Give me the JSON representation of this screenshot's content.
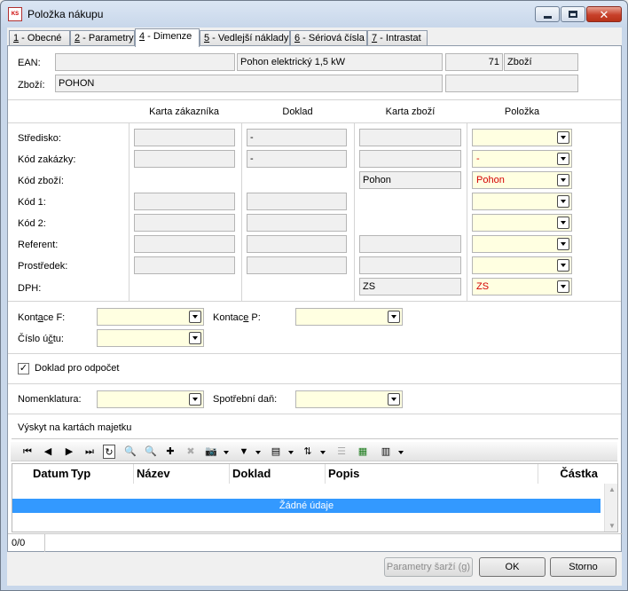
{
  "window": {
    "title": "Položka nákupu",
    "icon": "kos-app-icon"
  },
  "tabs": [
    {
      "key": "1",
      "label": " - Obecné"
    },
    {
      "key": "2",
      "label": " - Parametry"
    },
    {
      "key": "4",
      "label": " - Dimenze"
    },
    {
      "key": "5",
      "label": " - Vedlejší náklady"
    },
    {
      "key": "6",
      "label": " - Sériová čísla"
    },
    {
      "key": "7",
      "label": " - Intrastat"
    }
  ],
  "header": {
    "ean_label": "EAN:",
    "ean_value": "",
    "name": "Pohon elektrický 1,5 kW",
    "number": "71",
    "kind": "Zboží",
    "zbozi_label": "Zboží:",
    "zbozi_value": "POHON",
    "zbozi_extra": ""
  },
  "dims": {
    "columns": [
      "Karta zákazníka",
      "Doklad",
      "Karta zboží",
      "Položka"
    ],
    "rows": [
      {
        "label": "Středisko:",
        "doklad": "-",
        "karta_zbozi": "",
        "polozka": ""
      },
      {
        "label": "Kód zakázky:",
        "doklad": "-",
        "karta_zbozi": "",
        "polozka": "-"
      },
      {
        "label": "Kód zboží:",
        "doklad": "",
        "karta_zbozi": "Pohon",
        "polozka": "Pohon"
      },
      {
        "label": "Kód 1:",
        "doklad": "",
        "karta_zbozi": "",
        "polozka": ""
      },
      {
        "label": "Kód 2:",
        "doklad": "",
        "karta_zbozi": "",
        "polozka": ""
      },
      {
        "label": "Referent:",
        "doklad": "",
        "karta_zbozi": "",
        "polozka": ""
      },
      {
        "label": "Prostředek:",
        "doklad": "",
        "karta_zbozi": "",
        "polozka": ""
      },
      {
        "label": "DPH:",
        "doklad": "",
        "karta_zbozi": "ZS",
        "polozka": "ZS"
      }
    ]
  },
  "accounting": {
    "kontace_f_pre": "Kont",
    "kontace_f_ul": "a",
    "kontace_f_post": "ce F:",
    "kontace_f_value": "",
    "kontace_p_pre": "Kontac",
    "kontace_p_ul": "e",
    "kontace_p_post": " P:",
    "kontace_p_value": "",
    "cislo_uctu_pre": "Číslo ú",
    "cislo_uctu_ul": "č",
    "cislo_uctu_post": "tu:",
    "cislo_uctu_value": ""
  },
  "odpocet": {
    "label": "Doklad pro odpočet",
    "checked": "✓"
  },
  "misc": {
    "nomenklatura_label": "Nomenklatura:",
    "nomenklatura_value": "",
    "spotrebni_dan_label": "Spotřební daň:",
    "spotrebni_dan_value": ""
  },
  "assets": {
    "section_title": "Výskyt na kartách majetku",
    "columns": [
      "Datum",
      "Typ",
      "Název",
      "Doklad",
      "Popis",
      "Částka"
    ],
    "empty_text": "Žádné údaje"
  },
  "status": {
    "record_count": "0/0"
  },
  "buttons": {
    "parametry_sarzi": "Parametry šarží (g)",
    "ok": "OK",
    "storno": "Storno"
  },
  "colors": {
    "active_row": "#3399ff",
    "required_field": "#ffffe1",
    "value_red": "#d40000"
  }
}
